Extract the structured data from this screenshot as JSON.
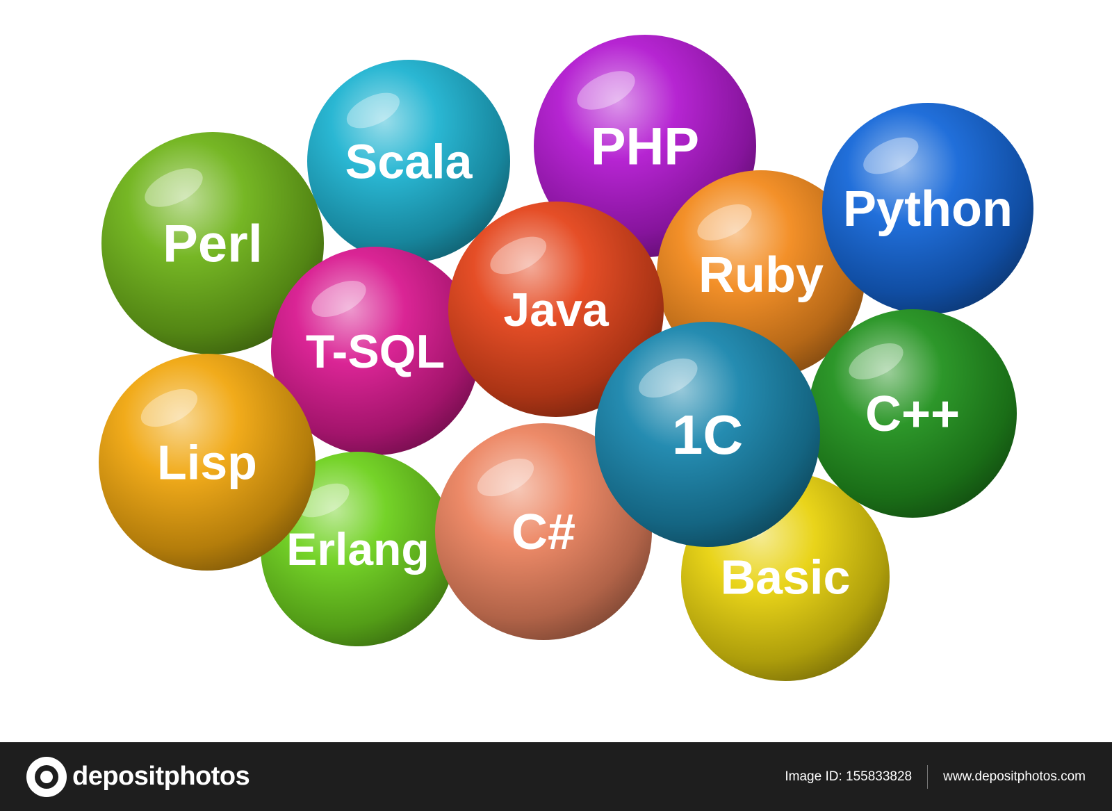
{
  "spheres": [
    {
      "label": "Scala",
      "color": "#1fb3d1"
    },
    {
      "label": "PHP",
      "color": "#b21ad0"
    },
    {
      "label": "Perl",
      "color": "#6fb31a"
    },
    {
      "label": "Python",
      "color": "#1567d8"
    },
    {
      "label": "Ruby",
      "color": "#f28a1e"
    },
    {
      "label": "T-SQL",
      "color": "#d81a8f"
    },
    {
      "label": "Java",
      "color": "#e4451c"
    },
    {
      "label": "Lisp",
      "color": "#f0a70f"
    },
    {
      "label": "Erlang",
      "color": "#6ed11e"
    },
    {
      "label": "C#",
      "color": "#ec8460"
    },
    {
      "label": "1C",
      "color": "#1a86ad"
    },
    {
      "label": "C++",
      "color": "#22921f"
    },
    {
      "label": "Basic",
      "color": "#e8d20e"
    }
  ],
  "footer": {
    "brand": "depositphotos",
    "image_id": "Image ID: 155833828",
    "url": "www.depositphotos.com"
  }
}
